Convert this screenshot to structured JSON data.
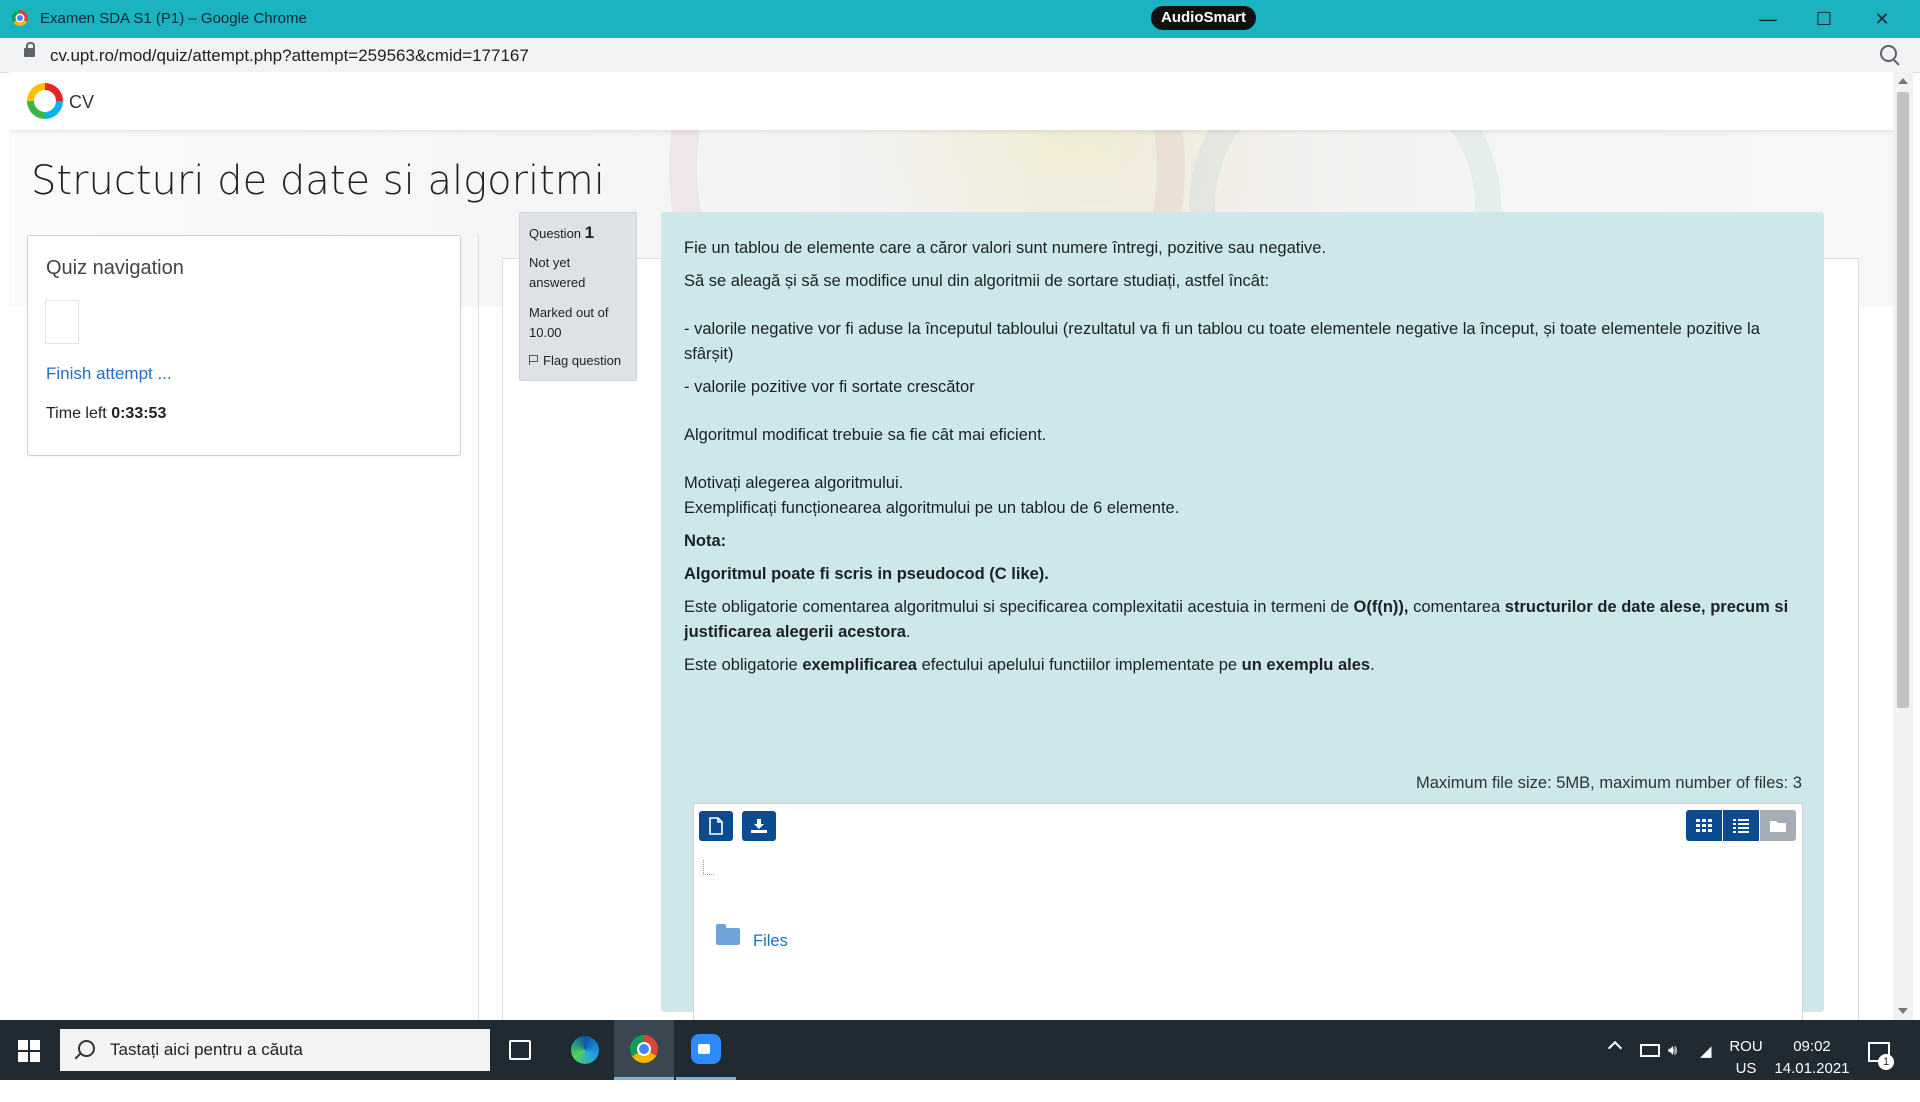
{
  "browser": {
    "window_title": "Examen SDA S1 (P1) – Google Chrome",
    "overlay_badge": "AudioSmart",
    "url": "cv.upt.ro/mod/quiz/attempt.php?attempt=259563&cmid=177167"
  },
  "site": {
    "name": "CV",
    "course_title": "Structuri de date si algoritmi"
  },
  "quiz_nav": {
    "title": "Quiz navigation",
    "finish_link": "Finish attempt ...",
    "time_left_label": "Time left",
    "time_left_value": "0:33:53"
  },
  "question": {
    "label": "Question",
    "number": "1",
    "state": "Not yet answered",
    "grade": "Marked out of 10.00",
    "flag": "Flag question",
    "text": {
      "p1": "Fie un tablou de elemente care a căror valori sunt numere întregi,  pozitive sau negative.",
      "p2": "Să se aleagă și să se modifice unul din algoritmii de sortare studiați, astfel încât:",
      "p3": "- valorile negative vor fi aduse la începutul tabloului (rezultatul va fi un tablou cu toate elementele negative la început, și toate elementele pozitive la sfârșit)",
      "p4": "- valorile pozitive vor fi sortate crescător",
      "p5": "Algoritmul modificat trebuie sa fie cât mai eficient.",
      "p6": "Motivați alegerea algoritmului.",
      "p7": "Exemplificați funcționearea algoritmului pe un tablou de 6 elemente.",
      "p8": "Nota:",
      "p9": "Algoritmul poate fi scris in pseudocod (C like).",
      "p10a": "Este obligatorie comentarea algoritmului si specificarea complexitatii acestuia in termeni de ",
      "p10b": "O(f(n)),",
      "p10c": " comentarea ",
      "p10d": "structurilor de date alese, precum si justificarea alegerii acestora",
      "p10e": ".",
      "p11a": "Este obligatorie ",
      "p11b": "exemplificarea",
      "p11c": " efectului apelului functiilor implementate pe ",
      "p11d": "un exemplu ales",
      "p11e": "."
    }
  },
  "filepicker": {
    "max_info": "Maximum file size: 5MB, maximum number of files: 3",
    "folder_label": "Files"
  },
  "taskbar": {
    "search_placeholder": "Tastați aici pentru a căuta",
    "lang_top": "ROU",
    "lang_bottom": "US",
    "time": "09:02",
    "date": "14.01.2021",
    "notif_count": "1"
  }
}
